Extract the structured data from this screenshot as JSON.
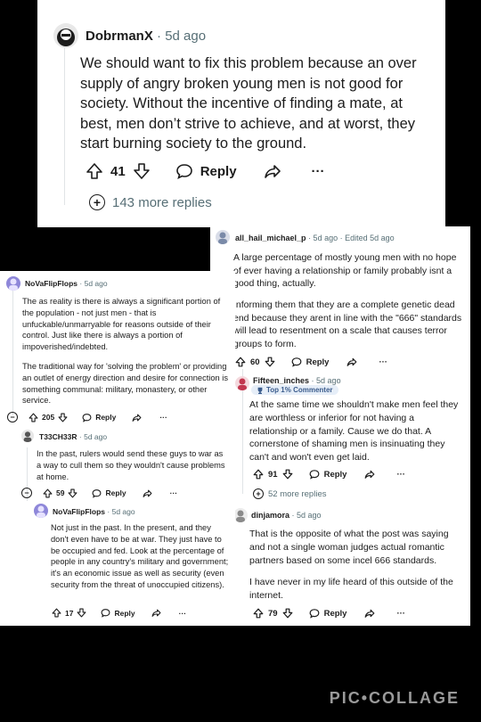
{
  "card1": {
    "username": "DobrmanX",
    "sep": "·",
    "time": "5d ago",
    "body": "We should want to fix this problem because an over supply of angry broken young men is not good for society. Without the incentive of finding a mate, at best, men don’t strive to achieve, and at worst, they start burning society to the ground.",
    "votes": "41",
    "reply": "Reply",
    "more_dots": "···",
    "more_replies": "143 more replies"
  },
  "card2": {
    "username": "all_hail_michael_p",
    "time": "· 5d ago · Edited 5d ago",
    "body1": "A large percentage of mostly young men with no hope of ever having a relationship or family probably isnt a good thing, actually.",
    "body2": "Informing them that they are a complete genetic dead end because they arent in line with the \"666\" standards will lead to resentment on a scale that causes terror groups to form.",
    "votes": "60",
    "reply": "Reply",
    "more_dots": "···",
    "reply1": {
      "username": "Fifteen_inches",
      "time": "· 5d ago",
      "badge": "Top 1% Commenter",
      "body": "At the same time we shouldn't make men feel they are worthless or inferior for not having a relationship or a family. Cause we do that. A cornerstone of shaming men is insinuating they can't and won't even get laid.",
      "votes": "91",
      "reply": "Reply",
      "more_dots": "···",
      "more_replies": "52 more replies"
    },
    "reply2": {
      "username": "dinjamora",
      "time": "· 5d ago",
      "body1": "That is the opposite of what the post was saying and not a single woman judges actual romantic partners based on some incel 666 standards.",
      "body2": "I have never in my life heard of this outside of the internet.",
      "votes": "79",
      "reply": "Reply",
      "more_dots": "···"
    }
  },
  "card3": {
    "username": "NoVaFlipFlops",
    "time": "· 5d ago",
    "body1": "The as reality is there is always a significant portion of the population - not just men - that is unfuckable/unmarryable for reasons outside of their control. Just like there is always a portion of impoverished/indebted.",
    "body2": "The traditional way for 'solving the problem' or providing an outlet of energy direction and desire for connection is something communal: military, monastery, or other service.",
    "collapse": "−",
    "votes": "205",
    "reply": "Reply",
    "more_dots": "···",
    "reply1": {
      "username": "T33CH33R",
      "time": "· 5d ago",
      "body": "In the past, rulers would send these guys to war as a way to cull them so they wouldn't cause problems at home.",
      "collapse": "−",
      "votes": "59",
      "reply": "Reply",
      "more_dots": "···"
    },
    "reply2": {
      "username": "NoVaFlipFlops",
      "time": "· 5d ago",
      "body": "Not just in the past. In the present, and they don't even have to be at war. They just have to be occupied and fed. Look at the percentage of people in any country's military and government; it's an economic issue as well as security (even security from the threat of unoccupied citizens).",
      "votes": "17",
      "reply": "Reply",
      "more_dots": "···"
    }
  },
  "watermark": "PIC•COLLAGE",
  "colors": {
    "background": "#000000",
    "card": "#ffffff",
    "meta": "#576f76",
    "badge_bg": "#e6eef8",
    "badge_text": "#3b5c8c"
  }
}
